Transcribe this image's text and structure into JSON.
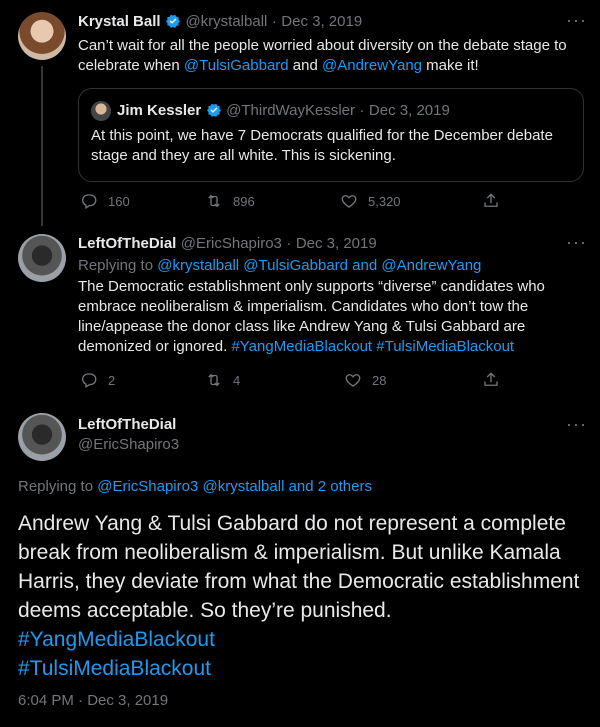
{
  "tweet1": {
    "name": "Krystal Ball",
    "handle": "@krystalball",
    "sep": "·",
    "date": "Dec 3, 2019",
    "text_a": "Can’t wait for all the people worried about diversity on the debate stage to celebrate when ",
    "mention1": "@TulsiGabbard",
    "text_b": " and ",
    "mention2": "@AndrewYang",
    "text_c": " make it!",
    "quote": {
      "name": "Jim Kessler",
      "handle": "@ThirdWayKessler",
      "date": "Dec 3, 2019",
      "text": "At this point, we have 7 Democrats qualified for the December debate stage and they are all white. This is sickening."
    },
    "replies": "160",
    "retweets": "896",
    "likes": "5,320"
  },
  "tweet2": {
    "name": "LeftOfTheDial",
    "handle": "@EricShapiro3",
    "date": "Dec 3, 2019",
    "replying_label": "Replying to ",
    "replying_to": "@krystalball @TulsiGabbard and @AndrewYang",
    "text": "The Democratic establishment only supports “diverse” candidates who embrace neoliberalism & imperialism. Candidates who don’t tow the line/appease the donor class like Andrew Yang & Tulsi Gabbard are demonized or ignored. ",
    "hashtags": "#YangMediaBlackout #TulsiMediaBlackout",
    "replies": "2",
    "retweets": "4",
    "likes": "28"
  },
  "tweet3": {
    "name": "LeftOfTheDial",
    "handle": "@EricShapiro3",
    "replying_label": "Replying to ",
    "replying_to": "@EricShapiro3 @krystalball and 2 others",
    "text": "Andrew Yang & Tulsi Gabbard do not represent a complete break from neoliberalism & imperialism. But unlike Kamala Harris, they deviate from what the Democratic establishment deems acceptable. So they’re punished. ",
    "hashtag1": "#YangMediaBlackout",
    "hashtag2": "#TulsiMediaBlackout",
    "timestamp": "6:04 PM · Dec 3, 2019"
  },
  "icons": {
    "more": "···"
  }
}
